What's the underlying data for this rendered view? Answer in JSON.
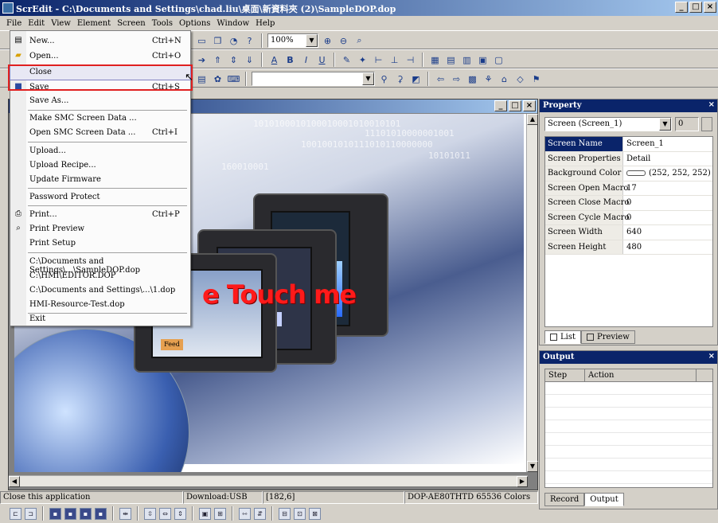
{
  "window": {
    "title": "ScrEdit - C:\\Documents and Settings\\chad.liu\\桌面\\新資料夾 (2)\\SampleDOP.dop",
    "controls": [
      "_",
      "□",
      "×"
    ]
  },
  "menubar": {
    "items": [
      "File",
      "Edit",
      "View",
      "Element",
      "Screen",
      "Tools",
      "Options",
      "Window",
      "Help"
    ]
  },
  "toolbar": {
    "zoom_value": "100%"
  },
  "file_menu": {
    "items": [
      {
        "label": "New...",
        "shortcut": "Ctrl+N"
      },
      {
        "label": "Open...",
        "shortcut": "Ctrl+O"
      },
      {
        "label": "Close",
        "shortcut": ""
      },
      {
        "label": "Save",
        "shortcut": "Ctrl+S"
      },
      {
        "label": "Save As...",
        "shortcut": ""
      },
      {
        "label": "Make SMC Screen Data ...",
        "shortcut": ""
      },
      {
        "label": "Open SMC Screen Data ...",
        "shortcut": "Ctrl+I"
      },
      {
        "label": "Upload...",
        "shortcut": ""
      },
      {
        "label": "Upload Recipe...",
        "shortcut": ""
      },
      {
        "label": "Update Firmware",
        "shortcut": ""
      },
      {
        "label": "Password Protect",
        "shortcut": ""
      },
      {
        "label": "Print...",
        "shortcut": "Ctrl+P"
      },
      {
        "label": "Print Preview",
        "shortcut": ""
      },
      {
        "label": "Print Setup",
        "shortcut": ""
      },
      {
        "label": "C:\\Documents and Settings\\...\\SampleDOP.dop",
        "shortcut": ""
      },
      {
        "label": "C:\\HMI\\EDITOR.DOP",
        "shortcut": ""
      },
      {
        "label": "C:\\Documents and Settings\\...\\1.dop",
        "shortcut": ""
      },
      {
        "label": "HMI-Resource-Test.dop",
        "shortcut": ""
      },
      {
        "label": "Exit",
        "shortcut": ""
      }
    ]
  },
  "canvas": {
    "banner_text": "e Touch me",
    "binary_lines": [
      "1010100010100010001010010101",
      "11101010000001001",
      "1001001010111010110000000",
      "10101011",
      "160010001"
    ],
    "device_brand": "DELTA",
    "device_button_label": "Feed"
  },
  "property_panel": {
    "title": "Property",
    "selector": "Screen (Screen_1)",
    "selector_index": "0",
    "rows": [
      {
        "key": "Screen Name",
        "value": "Screen_1"
      },
      {
        "key": "Screen Properties",
        "value": "Detail"
      },
      {
        "key": "Background Color",
        "value": "(252, 252, 252)"
      },
      {
        "key": "Screen Open Macro",
        "value": "17"
      },
      {
        "key": "Screen Close Macro",
        "value": "0"
      },
      {
        "key": "Screen Cycle Macro",
        "value": "0"
      },
      {
        "key": "Screen Width",
        "value": "640"
      },
      {
        "key": "Screen Height",
        "value": "480"
      }
    ],
    "tabs": [
      "List",
      "Preview"
    ]
  },
  "output_panel": {
    "title": "Output",
    "columns": [
      "Step",
      "Action"
    ],
    "tabs": [
      "Record",
      "Output"
    ]
  },
  "statusbar": {
    "hint": "Close this application",
    "download": "Download:USB",
    "coords": "[182,6]",
    "model": "DOP-AE80THTD 65536 Colors"
  },
  "colors": {
    "title_active": "#0a246a",
    "highlight_box": "#e02020",
    "banner": "#ff1a1a"
  }
}
